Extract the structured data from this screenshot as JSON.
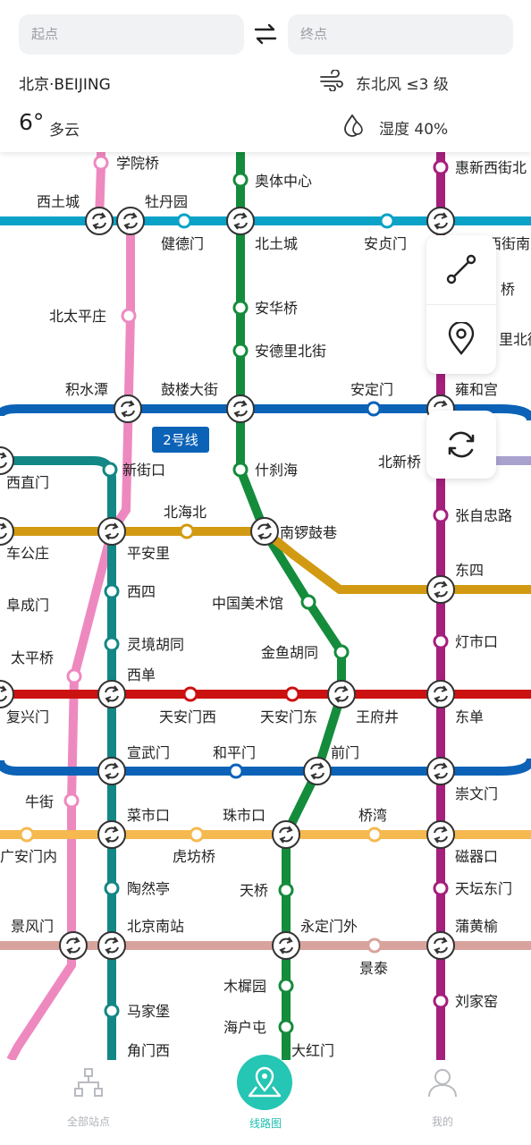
{
  "route": {
    "from_placeholder": "起点",
    "to_placeholder": "终点"
  },
  "weather": {
    "city": "北京·BEIJING",
    "wind": "东北风 ≤3 级",
    "temperature": "6°",
    "condition": "多云",
    "humidity": "湿度 40%"
  },
  "map": {
    "line_badge": "2号线",
    "stations": {
      "xueyuanqiao": "学院桥",
      "xitucheng": "西土城",
      "mudanyuan": "牡丹园",
      "aotizhongxin": "奥体中心",
      "huixinxijiebei": "惠新西街北",
      "jiandemen": "健德门",
      "beitucheng": "北土城",
      "anzhenmen": "安贞门",
      "xijienan": "西街南",
      "beitaipingzhuang": "北太平庄",
      "anhuaqiao": "安华桥",
      "anhuaqiao_r": "桥",
      "andelibeijie": "安德里北街",
      "libeijie_r": "里北街",
      "jishuitan": "积水潭",
      "gulou": "鼓楼大街",
      "andingmen": "安定门",
      "yonghegong": "雍和宫",
      "xizhimen": "西直门",
      "xinjiekou": "新街口",
      "shichahai": "什刹海",
      "beixinqiao": "北新桥",
      "zhangzizhonglu": "张自忠路",
      "beihaibei": "北海北",
      "chegongzhuang": "车公庄",
      "pinganli": "平安里",
      "nanluoguxiang": "南锣鼓巷",
      "dongsi": "东四",
      "fuchengmen": "阜成门",
      "xisi": "西四",
      "meishuguan": "中国美术馆",
      "lingjing": "灵境胡同",
      "dengshikou": "灯市口",
      "taipingqiao": "太平桥",
      "xidan": "西单",
      "jinyu": "金鱼胡同",
      "fuxingmen": "复兴门",
      "tiananmenxi": "天安门西",
      "tiananmendong": "天安门东",
      "wangfujing": "王府井",
      "dongdan": "东单",
      "xuanwumen": "宣武门",
      "hepingmen": "和平门",
      "qianmen": "前门",
      "chongwenmen": "崇文门",
      "niujie": "牛街",
      "caishikou": "菜市口",
      "zhushikou": "珠市口",
      "qiaowan": "桥湾",
      "guanganmennei": "广安门内",
      "hufangqiao": "虎坊桥",
      "ciqikou": "磁器口",
      "taoranting": "陶然亭",
      "tianqiao": "天桥",
      "tiantandongmen": "天坛东门",
      "jingfengmen": "景风门",
      "beijingnan": "北京南站",
      "yongdingmenwai": "永定门外",
      "puhuangyu": "蒲黄榆",
      "jingtai": "景泰",
      "muxiyuan": "木樨园",
      "majiapu": "马家堡",
      "liujiayao": "刘家窑",
      "haihutun": "海户屯",
      "jiaomenxi": "角门西",
      "dahongmen": "大红门"
    }
  },
  "nav": {
    "all_stations": "全部站点",
    "route_map": "线路图",
    "mine": "我的"
  },
  "icons": [
    "swap-icon",
    "wind-icon",
    "humidity-icon",
    "route-icon",
    "location-pin-icon",
    "refresh-icon",
    "station-tree-icon",
    "map-pin-icon",
    "user-icon",
    "transfer-icon"
  ],
  "colors": {
    "accent": "#25c6b3",
    "line2": "#0b62b7",
    "line8": "#148c3c",
    "line4": "#138785",
    "line1": "#cc1111",
    "line5": "#a51f7d",
    "line6": "#d29a12",
    "line7": "#f5b94f",
    "line10": "#0aa2c7",
    "line13": "#ee89c0",
    "line14": "#d8a39c",
    "line_purple": "#a9a2cf"
  }
}
